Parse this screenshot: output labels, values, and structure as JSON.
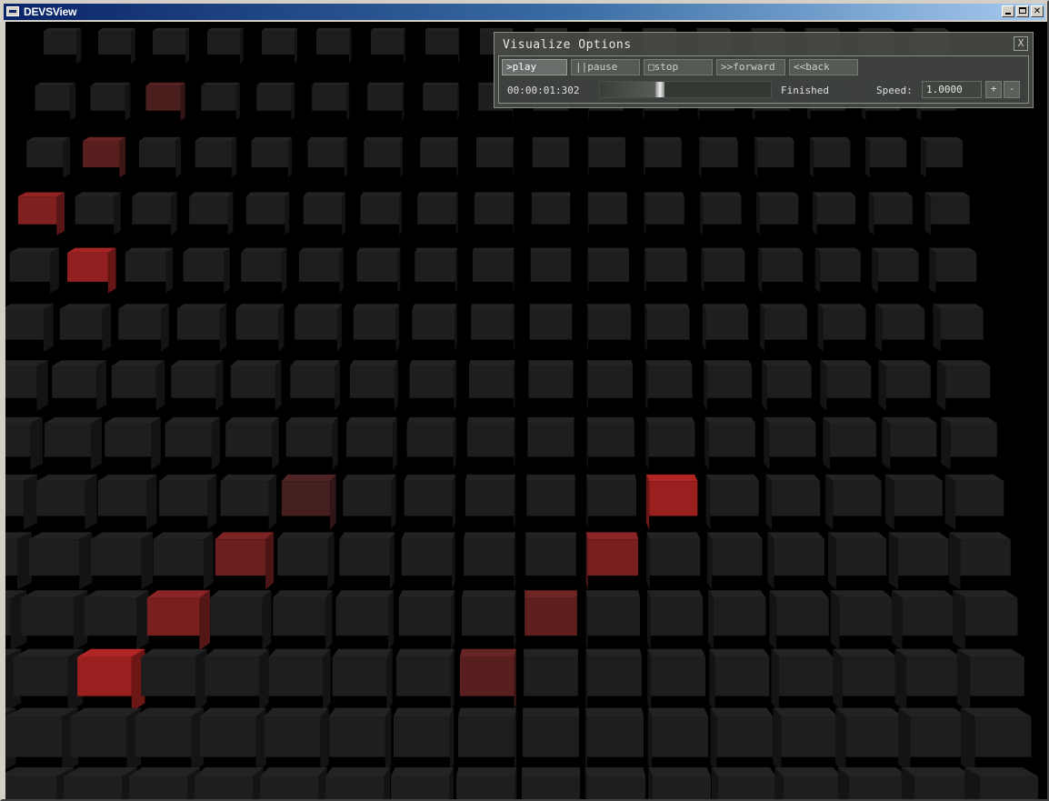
{
  "window": {
    "title": "DEVSView",
    "controls": {
      "minimize": "_",
      "maximize": "□",
      "close": "✕"
    }
  },
  "scene": {
    "description_colors": {
      "background": "#000000",
      "cell_inactive": "#1e1e1e",
      "cell_active": "#a02020"
    },
    "grid": {
      "rows": 14,
      "cols": 17
    },
    "active_cells": [
      {
        "row": 1,
        "col": 2,
        "level": 0.35
      },
      {
        "row": 2,
        "col": 1,
        "level": 0.45
      },
      {
        "row": 3,
        "col": 0,
        "level": 0.75
      },
      {
        "row": 4,
        "col": 1,
        "level": 0.9
      },
      {
        "row": 8,
        "col": 5,
        "level": 0.3
      },
      {
        "row": 8,
        "col": 11,
        "level": 0.95
      },
      {
        "row": 9,
        "col": 4,
        "level": 0.6
      },
      {
        "row": 9,
        "col": 10,
        "level": 0.7
      },
      {
        "row": 10,
        "col": 3,
        "level": 0.7
      },
      {
        "row": 10,
        "col": 9,
        "level": 0.5
      },
      {
        "row": 11,
        "col": 2,
        "level": 0.95
      },
      {
        "row": 11,
        "col": 8,
        "level": 0.45
      }
    ]
  },
  "visualize_options": {
    "title": "Visualize Options",
    "close_label": "X",
    "buttons": {
      "play": ">play",
      "pause": "||pause",
      "stop": "□stop",
      "forward": ">>forward",
      "back": "<<back"
    },
    "time": "00:00:01:302",
    "progress": 0.35,
    "status": "Finished",
    "speed_label": "Speed:",
    "speed_value": "1.0000",
    "speed_plus": "+",
    "speed_minus": "-"
  }
}
